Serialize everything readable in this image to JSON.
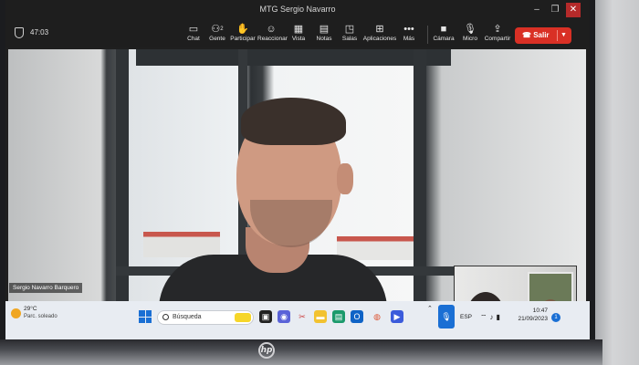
{
  "window": {
    "title": "MTG Sergio Navarro"
  },
  "meeting": {
    "timer": "47:03",
    "toolbar": [
      {
        "label": "Chat",
        "icon": "chat-icon"
      },
      {
        "label": "Gente",
        "icon": "people-icon",
        "badge": "2"
      },
      {
        "label": "Participar",
        "icon": "raise-hand-icon"
      },
      {
        "label": "Reaccionar",
        "icon": "emoji-icon"
      },
      {
        "label": "Vista",
        "icon": "view-icon"
      },
      {
        "label": "Notas",
        "icon": "notes-icon"
      },
      {
        "label": "Salas",
        "icon": "rooms-icon"
      },
      {
        "label": "Aplicaciones",
        "icon": "apps-icon"
      },
      {
        "label": "Más",
        "icon": "more-icon"
      },
      {
        "label": "Cámara",
        "icon": "camera-icon"
      },
      {
        "label": "Micro",
        "icon": "mic-icon"
      },
      {
        "label": "Compartir",
        "icon": "share-icon"
      }
    ],
    "leave_label": "Salir",
    "participant_name": "Sergio Navarro Barquero"
  },
  "taskbar": {
    "weather_temp": "29°C",
    "weather_desc": "Parc. soleado",
    "search_placeholder": "Búsqueda",
    "language": "ESP",
    "time": "10:47",
    "date": "21/09/2023",
    "notification_count": "1"
  },
  "device": {
    "brand": "hp"
  },
  "colors": {
    "leave": "#d93025",
    "accent": "#1a6fd4",
    "toolbar_bg": "#1e1e1e"
  }
}
